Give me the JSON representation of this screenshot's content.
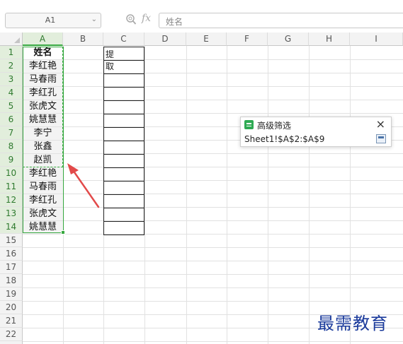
{
  "formula_bar": {
    "name_box": "A1",
    "fx_label": "fx",
    "formula_text": "姓名"
  },
  "columns": [
    "A",
    "B",
    "C",
    "D",
    "E",
    "F",
    "G",
    "H",
    "I"
  ],
  "rows": [
    "1",
    "2",
    "3",
    "4",
    "5",
    "6",
    "7",
    "8",
    "9",
    "10",
    "11",
    "12",
    "13",
    "14",
    "15",
    "16",
    "17",
    "18",
    "19",
    "20",
    "21",
    "22",
    "23"
  ],
  "column_a": [
    "姓名",
    "李红艳",
    "马春雨",
    "李红孔",
    "张虎文",
    "姚慧慧",
    "李宁",
    "张鑫",
    "赵凯",
    "李红艳",
    "马春雨",
    "李红孔",
    "张虎文",
    "姚慧慧"
  ],
  "column_c_header": "提取",
  "dialog": {
    "title": "高级筛选",
    "range_value": "Sheet1!$A$2:$A$9",
    "close_label": "×"
  },
  "watermark": "最需教育",
  "colors": {
    "selection_green": "#36a83f",
    "arrow_red": "#e24a4a",
    "watermark_blue": "#1a3a9b"
  }
}
